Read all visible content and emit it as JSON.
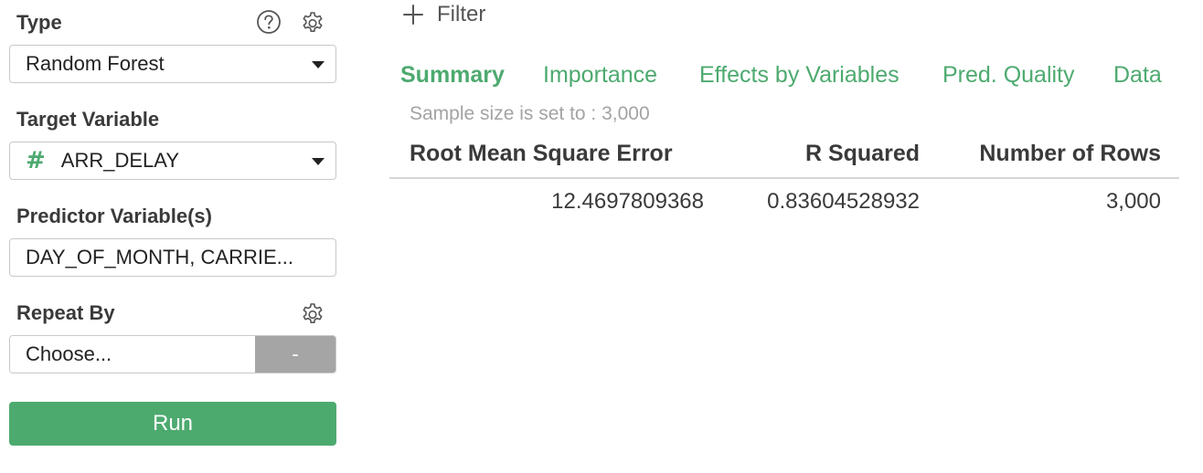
{
  "left_panel": {
    "type": {
      "label": "Type",
      "selected": "Random Forest"
    },
    "target": {
      "label": "Target Variable",
      "type_symbol": "#",
      "selected": "ARR_DELAY"
    },
    "predictor": {
      "label": "Predictor Variable(s)",
      "value": "DAY_OF_MONTH, CARRIE..."
    },
    "repeat_by": {
      "label": "Repeat By",
      "selected": "Choose...",
      "remove_label": "-"
    },
    "run_label": "Run"
  },
  "icons": {
    "help": "help-circle-icon",
    "settings": "gear-icon",
    "add": "plus-icon",
    "dropdown": "chevron-down-icon"
  },
  "colors": {
    "accent": "#4daa6f",
    "muted_button": "#a5a5a5",
    "muted_text": "#a3a3a3"
  },
  "filter": {
    "label": "Filter"
  },
  "tabs": [
    {
      "label": "Summary",
      "active": true
    },
    {
      "label": "Importance",
      "active": false
    },
    {
      "label": "Effects by Variables",
      "active": false
    },
    {
      "label": "Pred. Quality",
      "active": false
    },
    {
      "label": "Data",
      "active": false
    }
  ],
  "sample_note": "Sample size is set to : 3,000",
  "summary_table": {
    "columns": [
      "Root Mean Square Error",
      "R Squared",
      "Number of Rows"
    ],
    "rows": [
      [
        "12.4697809368",
        "0.83604528932",
        "3,000"
      ]
    ]
  }
}
